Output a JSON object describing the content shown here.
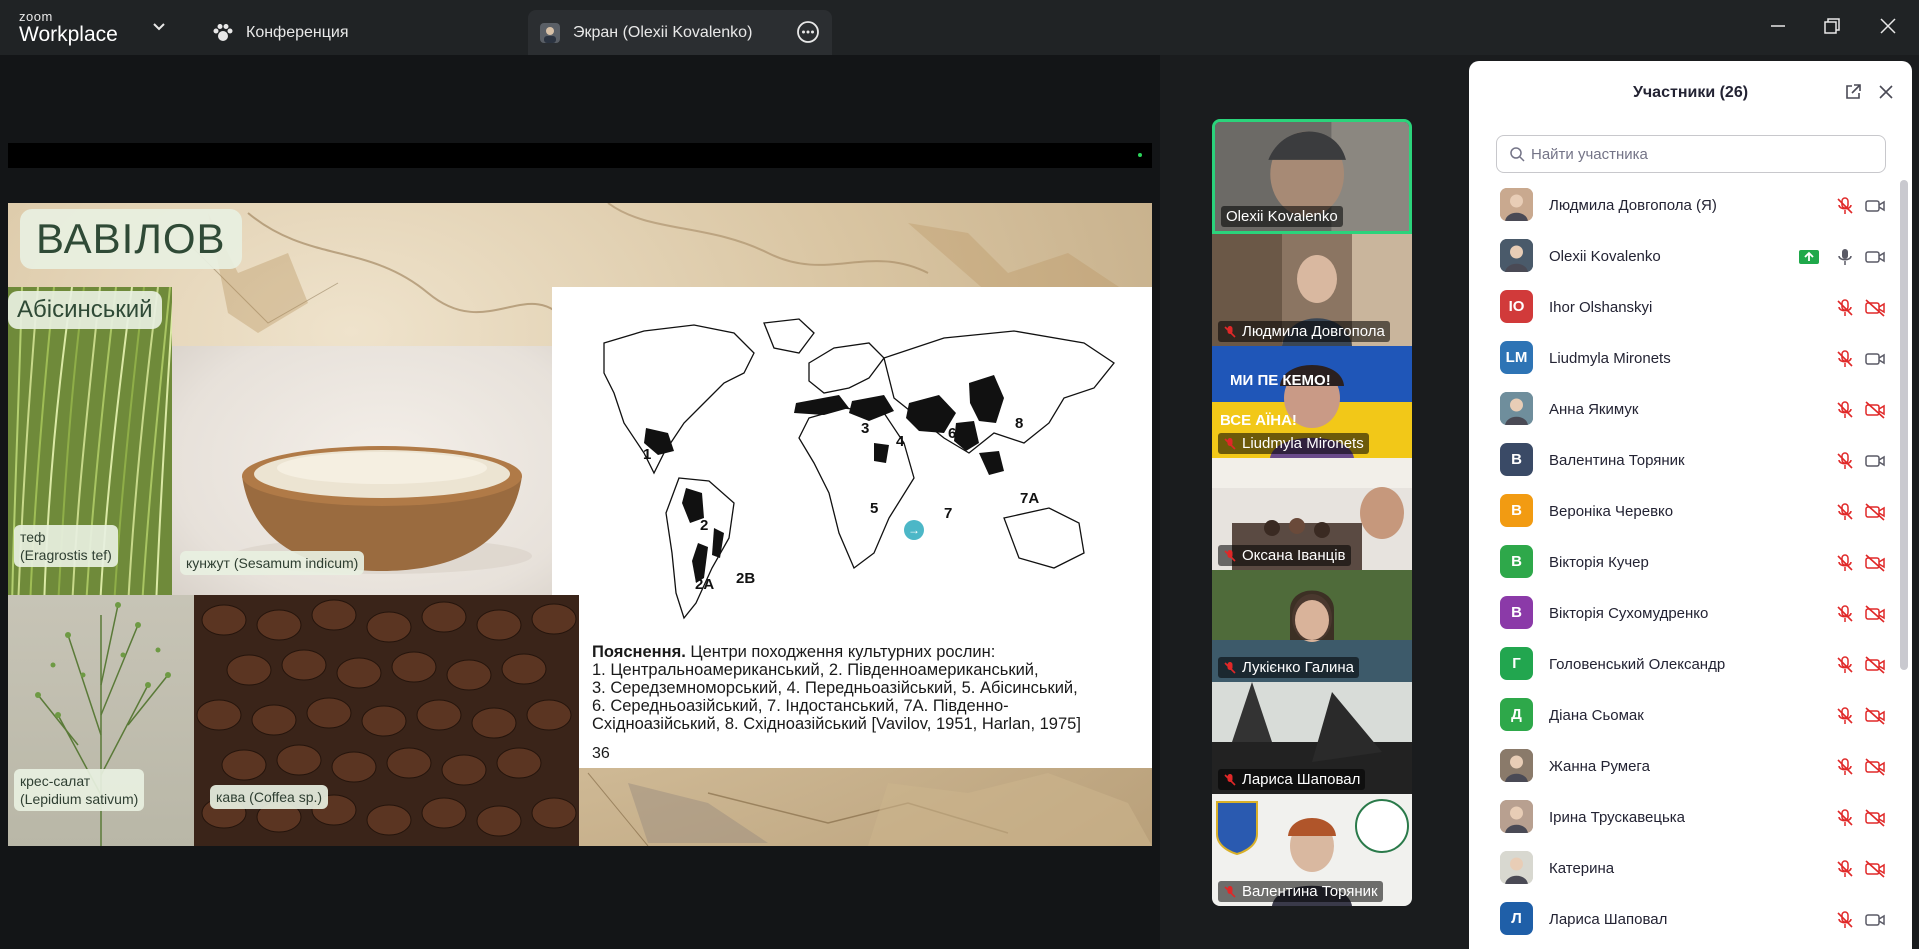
{
  "app": {
    "logo_line1": "zoom",
    "logo_line2": "Workplace"
  },
  "tabs": {
    "conference": "Конференция",
    "screen": "Экран (Olexii  Kovalenko)"
  },
  "slide": {
    "title": "ВАВІЛОВ",
    "subtitle": "Абісинський",
    "labels": {
      "tef_line1": "теф",
      "tef_line2": "(Eragrostis tef)",
      "sesame": "кунжут (Sesamum indicum)",
      "cress_line1": "крес-салат",
      "cress_line2": "(Lepidium sativum)",
      "coffee": "кава (Coffea sp.)"
    },
    "map_numbers": [
      "1",
      "2",
      "2A",
      "2B",
      "3",
      "4",
      "5",
      "6",
      "7",
      "7A",
      "8"
    ],
    "explanation_bold": "Пояснення.",
    "explanation_line1": " Центри походження культурних рослин:",
    "explanation_line2": "1. Центральноамериканський, 2. Південноамериканський,",
    "explanation_line3": "3. Середземноморський, 4. Передньоазійський, 5. Абісинський,",
    "explanation_line4": "6. Середньоазійський, 7. Індостанський, 7А. Південно-",
    "explanation_line5": "Східноазійський, 8. Східноазійський [Vavilov, 1951, Harlan, 1975]",
    "page_number": "36",
    "cursor_glyph": "→"
  },
  "videos": [
    {
      "name": "Olexii  Kovalenko",
      "muted": false,
      "active": true
    },
    {
      "name": "Людмила Довгопола",
      "muted": true
    },
    {
      "name": "Liudmyla Mironets",
      "muted": true,
      "banner_top": "МИ ПЕ    КЕМО!",
      "banner_bottom": "ВСЕ     АЇНА!"
    },
    {
      "name": "Оксана Іванців",
      "muted": true
    },
    {
      "name": "Лукієнко Галина",
      "muted": true
    },
    {
      "name": "Лариса Шаповал",
      "muted": true
    },
    {
      "name": "Валентина Торяник",
      "muted": true
    }
  ],
  "panel": {
    "title": "Участники (26)",
    "search_placeholder": "Найти участника",
    "participants": [
      {
        "name": "Людмила Довгопола (Я)",
        "avatar": "",
        "color": "#c9a98f",
        "photo": true,
        "mic": "muted",
        "cam": "on"
      },
      {
        "name": "Olexii  Kovalenko",
        "avatar": "",
        "color": "#4a5a6a",
        "photo": true,
        "mic": "on",
        "cam": "on",
        "sharing": true
      },
      {
        "name": "Ihor Olshanskyi",
        "avatar": "IO",
        "color": "#d13a3a",
        "mic": "muted",
        "cam": "off"
      },
      {
        "name": "Liudmyla Mironets",
        "avatar": "LM",
        "color": "#2e74b5",
        "mic": "muted",
        "cam": "on"
      },
      {
        "name": "Анна Якимук",
        "avatar": "",
        "color": "#6f8e9c",
        "photo": true,
        "mic": "muted",
        "cam": "off"
      },
      {
        "name": "Валентина Торяник",
        "avatar": "В",
        "color": "#3a4a66",
        "mic": "muted",
        "cam": "on"
      },
      {
        "name": "Вероніка Черевко",
        "avatar": "В",
        "color": "#f29b12",
        "mic": "muted",
        "cam": "off"
      },
      {
        "name": "Вікторія Кучер",
        "avatar": "В",
        "color": "#2ea84a",
        "mic": "muted",
        "cam": "off"
      },
      {
        "name": "Вікторія Сухомудренко",
        "avatar": "В",
        "color": "#8b3aa8",
        "mic": "muted",
        "cam": "off"
      },
      {
        "name": "Головенський Олександр",
        "avatar": "Г",
        "color": "#22a64f",
        "mic": "muted",
        "cam": "off"
      },
      {
        "name": "Діана Сьомак",
        "avatar": "Д",
        "color": "#2ea84a",
        "mic": "muted",
        "cam": "off"
      },
      {
        "name": "Жанна Румега",
        "avatar": "",
        "color": "#8a7a6a",
        "photo": true,
        "mic": "muted",
        "cam": "off"
      },
      {
        "name": "Ірина Трускавецька",
        "avatar": "",
        "color": "#b8a090",
        "photo": true,
        "mic": "muted",
        "cam": "off"
      },
      {
        "name": "Катерина",
        "avatar": "",
        "color": "#d8d8d0",
        "photo": true,
        "mic": "muted",
        "cam": "off"
      },
      {
        "name": "Лариса Шаповал",
        "avatar": "Л",
        "color": "#1f5fa8",
        "mic": "muted",
        "cam": "on"
      }
    ]
  },
  "colors": {
    "active_speaker": "#2bd37b",
    "muted_red": "#e02828",
    "share_green": "#1fa84a"
  }
}
